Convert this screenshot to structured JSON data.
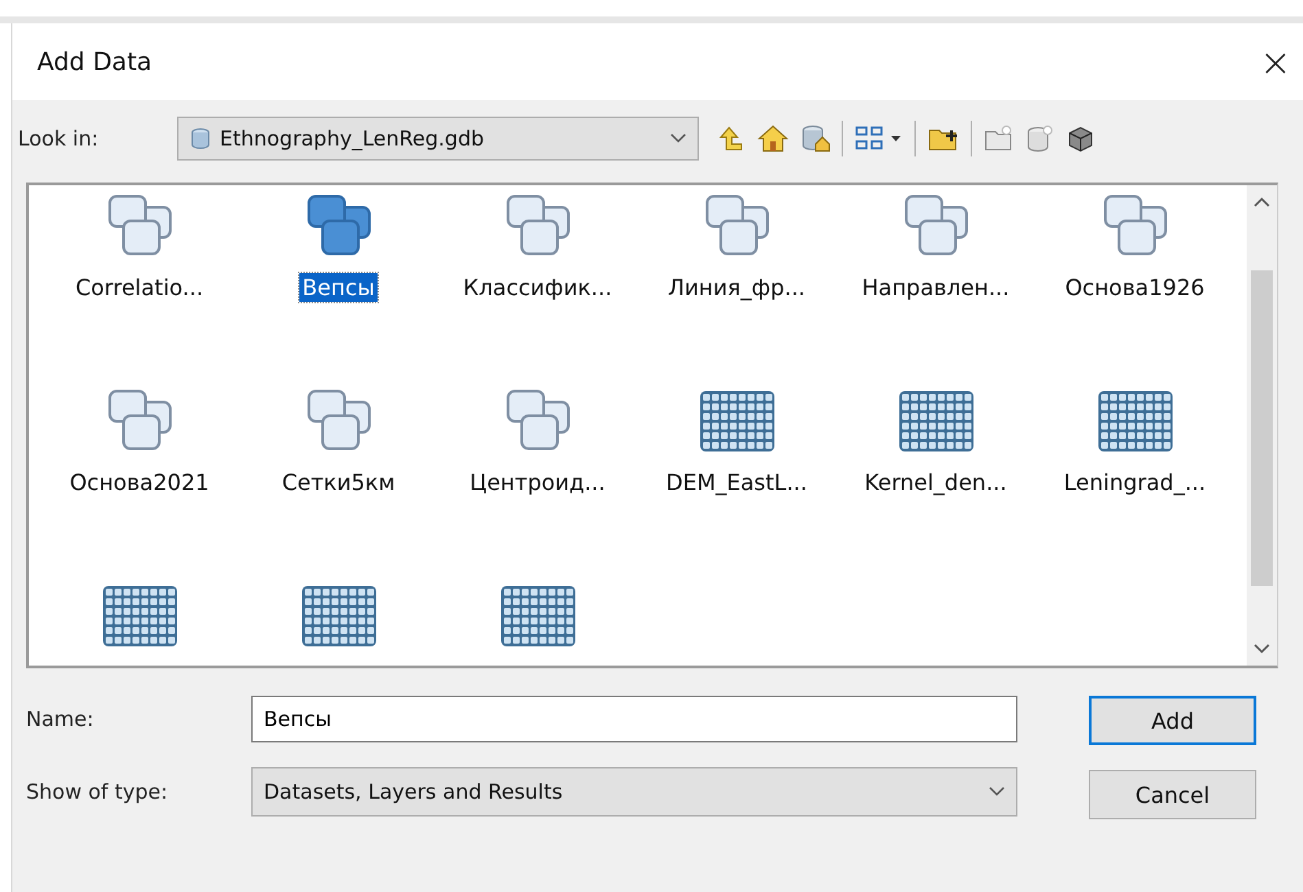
{
  "window": {
    "title": "Add Data",
    "close": "×"
  },
  "look_in": {
    "label": "Look in:",
    "value": "Ethnography_LenReg.gdb"
  },
  "toolbar": [
    {
      "kind": "up"
    },
    {
      "kind": "home"
    },
    {
      "kind": "db_home"
    },
    {
      "kind": "sep"
    },
    {
      "kind": "views"
    },
    {
      "kind": "sep"
    },
    {
      "kind": "connect"
    },
    {
      "kind": "sep"
    },
    {
      "kind": "new_folder"
    },
    {
      "kind": "new_db"
    },
    {
      "kind": "toolbox"
    }
  ],
  "items": [
    {
      "kind": "dataset",
      "label": "Correlatio...",
      "selected": false
    },
    {
      "kind": "dataset",
      "label": "Вепсы",
      "selected": true
    },
    {
      "kind": "dataset",
      "label": "Классифик...",
      "selected": false
    },
    {
      "kind": "dataset",
      "label": "Линия_фр...",
      "selected": false
    },
    {
      "kind": "dataset",
      "label": "Направлен...",
      "selected": false
    },
    {
      "kind": "dataset",
      "label": "Основа1926",
      "selected": false
    },
    {
      "kind": "dataset",
      "label": "Основа2021",
      "selected": false
    },
    {
      "kind": "dataset",
      "label": "Сетки5км",
      "selected": false
    },
    {
      "kind": "dataset",
      "label": "Центроид...",
      "selected": false
    },
    {
      "kind": "raster",
      "label": "DEM_EastL...",
      "selected": false
    },
    {
      "kind": "raster",
      "label": "Kernel_den...",
      "selected": false
    },
    {
      "kind": "raster",
      "label": "Leningrad_...",
      "selected": false
    },
    {
      "kind": "raster",
      "selected": false
    },
    {
      "kind": "raster",
      "selected": false
    },
    {
      "kind": "raster",
      "selected": false
    }
  ],
  "name": {
    "label": "Name:",
    "value": "Вепсы"
  },
  "show_type": {
    "label": "Show of type:",
    "value": "Datasets, Layers and Results"
  },
  "buttons": [
    {
      "label": "Add",
      "default": true
    },
    {
      "label": "Cancel",
      "default": false
    }
  ]
}
